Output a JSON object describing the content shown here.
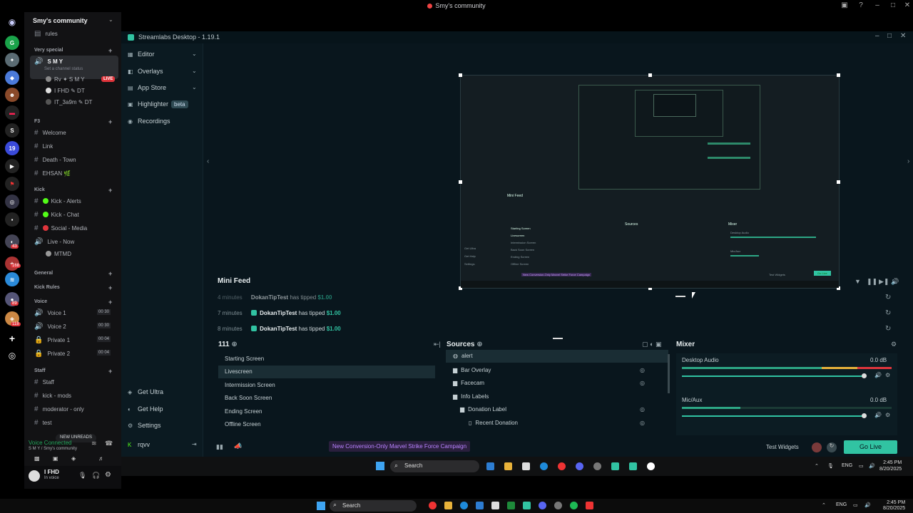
{
  "topbar": {
    "title": "Smy's community"
  },
  "discord": {
    "server_name": "Smy's community",
    "rules": "rules",
    "categories": {
      "very_special": "Very special",
      "f3": "F3",
      "kick": "Kick",
      "general": "General",
      "kick_rules": "Kick Rules",
      "voice": "Voice",
      "staff": "Staff"
    },
    "smy_channel": {
      "name": "S M Y",
      "status": "Set a channel status"
    },
    "smy_members": [
      "Rv ✦ S M Y",
      "I FHD ✎ DT",
      "IT_3a9m ✎ DT"
    ],
    "live_badge": "LIVE",
    "f3_channels": [
      "Welcome",
      "Link",
      "Death - Town",
      "EHSAN 🌿"
    ],
    "kick_channels": [
      "Kick - Alerts",
      "Kick - Chat",
      "Social - Media",
      "Live - Now"
    ],
    "kick_member": "MTMD",
    "voice_channels": [
      {
        "name": "Voice 1",
        "count": "00 30"
      },
      {
        "name": "Voice 2",
        "count": "00 30"
      },
      {
        "name": "Private 1",
        "count": "00 04"
      },
      {
        "name": "Private 2",
        "count": "00 04"
      }
    ],
    "staff_channels": [
      "Staff",
      "kick - mods",
      "moderator - only",
      "test"
    ],
    "new_unreads": "NEW UNREADS",
    "voice_connected": "Voice Connected",
    "voice_location": "S M Y / Smy's community",
    "user_name": "I FHD",
    "user_status": "In voice",
    "server_badges": [
      "43",
      "168",
      "89",
      "118"
    ]
  },
  "streamlabs": {
    "title": "Streamlabs Desktop - 1.19.1",
    "nav": {
      "editor": "Editor",
      "overlays": "Overlays",
      "app_store": "App Store",
      "highlighter": "Highlighter",
      "highlighter_badge": "beta",
      "recordings": "Recordings",
      "get_ultra": "Get Ultra",
      "get_help": "Get Help",
      "settings": "Settings",
      "user": "rqvv"
    },
    "preview_nested": {
      "mini_feed": "Mini Feed",
      "sources": "Sources",
      "mixer": "Mixer",
      "scenes": [
        "Starting Screen",
        "Livescreen",
        "Intermission Screen",
        "Back Soon Screen",
        "Ending Screen",
        "Offline Screen"
      ],
      "desktop_audio": "Desktop Audio",
      "mic_aux": "Mic/Aux",
      "test_widgets": "Test Widgets",
      "go_live": "Go Live",
      "promo": "New Conversion-Only Marvel Strike Force Campaign",
      "get_ultra": "Get Ultra",
      "get_help": "Get Help",
      "settings": "Settings"
    },
    "mini_feed": {
      "title": "Mini Feed",
      "rows": [
        {
          "time": "4 minutes",
          "name": "DokanTipTest",
          "action": "has tipped",
          "amount": "$1.00"
        },
        {
          "time": "7 minutes",
          "name": "DokanTipTest",
          "action": "has tipped",
          "amount": "$1.00"
        },
        {
          "time": "8 minutes",
          "name": "DokanTipTest",
          "action": "has tipped",
          "amount": "$1.00"
        }
      ]
    },
    "scenes": {
      "title": "111",
      "items": [
        "Starting Screen",
        "Livescreen",
        "Intermission Screen",
        "Back Soon Screen",
        "Ending Screen",
        "Offline Screen"
      ],
      "selected": "Livescreen"
    },
    "sources": {
      "title": "Sources",
      "items": [
        "alert",
        "Bar Overlay",
        "Facecam",
        "Info Labels",
        "Donation Label",
        "Recent Donation"
      ]
    },
    "mixer": {
      "title": "Mixer",
      "channels": [
        {
          "name": "Desktop Audio",
          "db": "0.0 dB"
        },
        {
          "name": "Mic/Aux",
          "db": "0.0 dB"
        }
      ]
    },
    "footer": {
      "promo": "New Conversion-Only Marvel Strike Force Campaign",
      "test_widgets": "Test Widgets",
      "go_live": "Go Live"
    }
  },
  "inner_taskbar": {
    "search": "Search",
    "lang": "ENG",
    "time": "2:45 PM",
    "date": "8/20/2025"
  },
  "taskbar": {
    "search": "Search",
    "lang": "ENG",
    "time": "2:45 PM",
    "date": "8/20/2025"
  },
  "colors": {
    "accent": "#31c3a2",
    "discord_bg": "#121214",
    "streamlabs_bg": "#09161d",
    "live_red": "#e0353c",
    "promo_purple": "#b882ff"
  }
}
